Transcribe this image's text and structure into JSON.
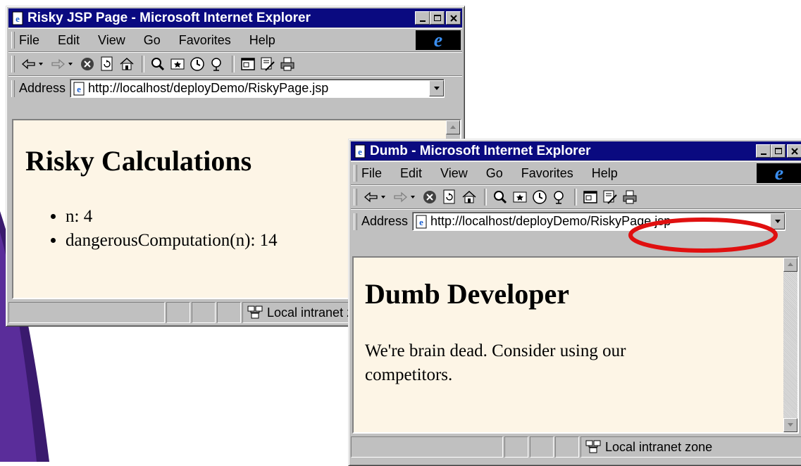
{
  "window1": {
    "title": "Risky JSP Page - Microsoft Internet Explorer",
    "menu": [
      "File",
      "Edit",
      "View",
      "Go",
      "Favorites",
      "Help"
    ],
    "address_label": "Address",
    "url": "http://localhost/deployDemo/RiskyPage.jsp",
    "heading": "Risky Calculations",
    "items": [
      "n: 4",
      "dangerousComputation(n): 14"
    ],
    "status_zone": "Local intranet zone"
  },
  "window2": {
    "title": "Dumb - Microsoft Internet Explorer",
    "menu": [
      "File",
      "Edit",
      "View",
      "Go",
      "Favorites",
      "Help"
    ],
    "address_label": "Address",
    "url": "http://localhost/deployDemo/RiskyPage.jsp",
    "heading": "Dumb Developer",
    "paragraph": "We're brain dead. Consider using our competitors.",
    "status_zone": "Local intranet zone"
  },
  "toolbar_icons": [
    "back-icon",
    "forward-icon",
    "stop-icon",
    "refresh-icon",
    "home-icon",
    "search-icon",
    "favorites-icon",
    "history-icon",
    "channels-icon",
    "fullscreen-icon",
    "mail-icon",
    "print-icon"
  ],
  "colors": {
    "titlebar": "#0a0a80",
    "window_face": "#c0c0c0",
    "page_background": "#fdf5e6",
    "highlight_ellipse": "#e01010",
    "slide_accent": "#3a1a6e"
  }
}
